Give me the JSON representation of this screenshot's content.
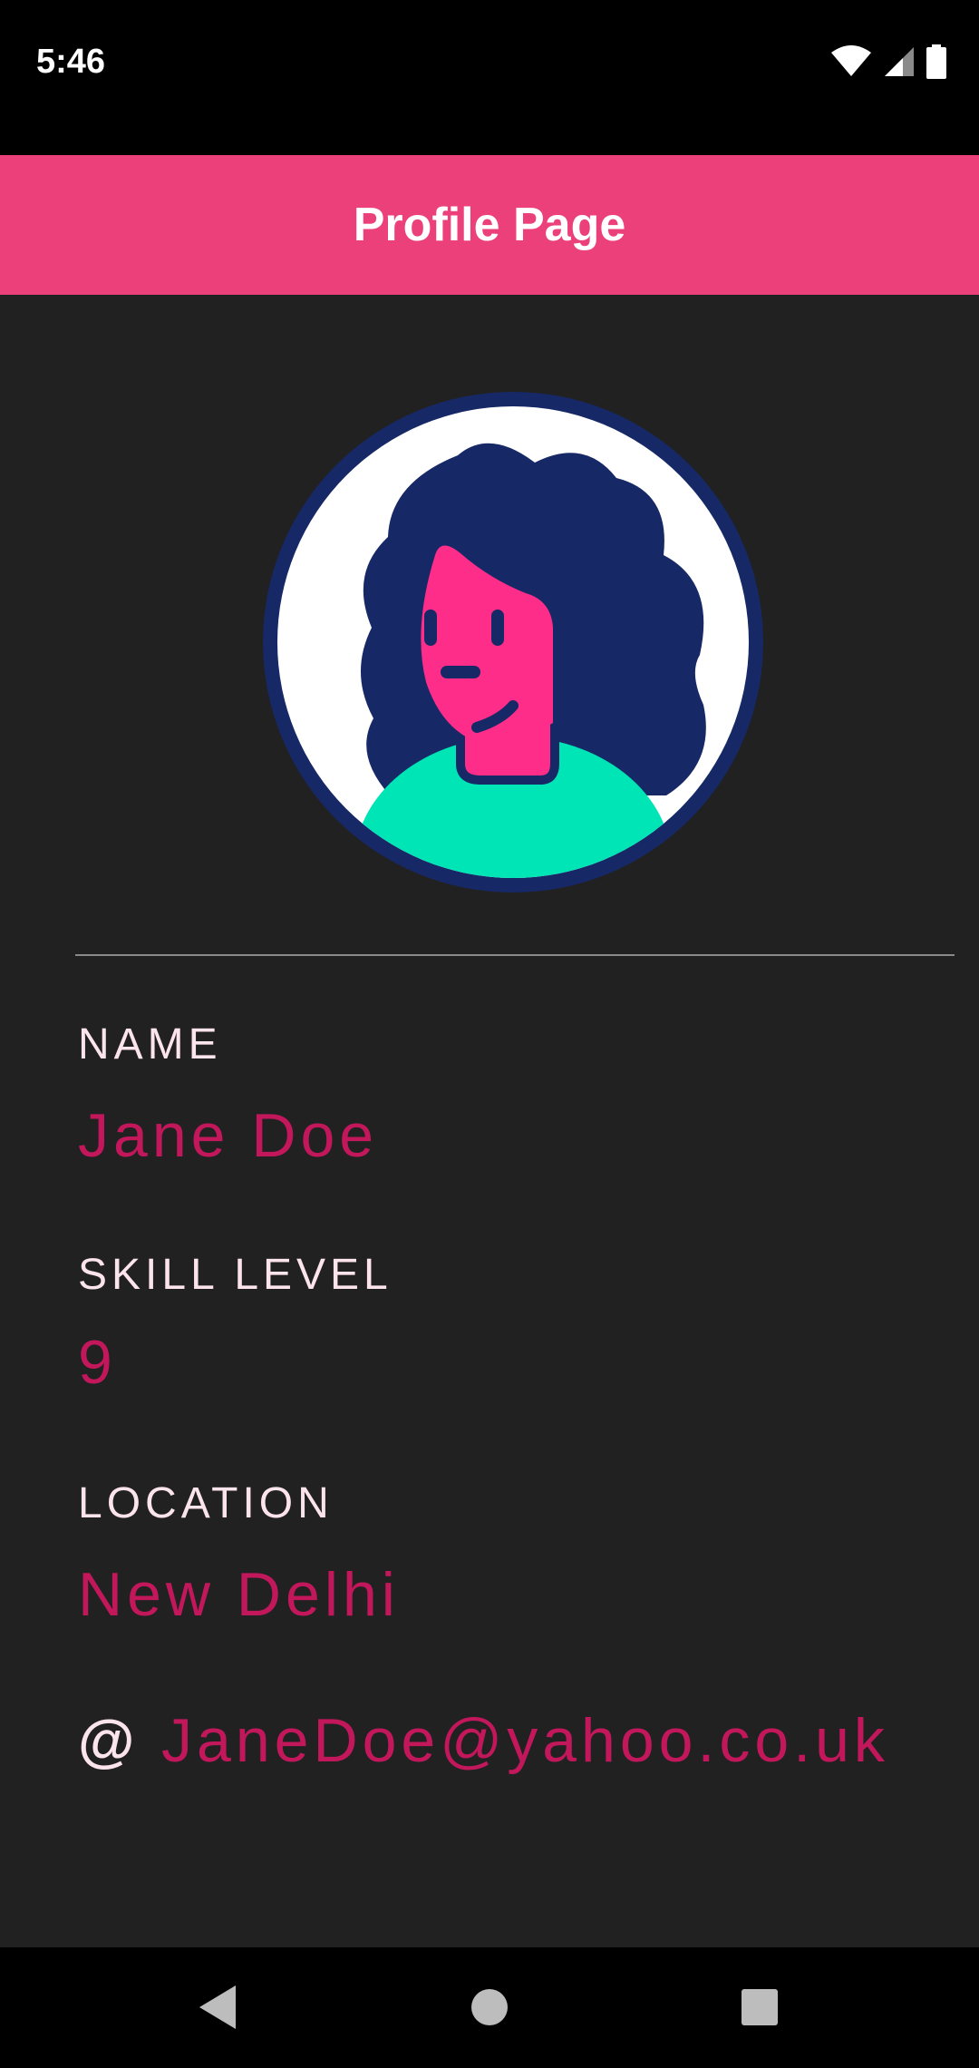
{
  "status_bar": {
    "time": "5:46",
    "icons": [
      "wifi-icon",
      "cell-signal-icon",
      "battery-icon"
    ]
  },
  "app_bar": {
    "title": "Profile Page",
    "color": "#EC407A"
  },
  "profile": {
    "avatar": "female-avatar",
    "fields": [
      {
        "label": "NAME",
        "value": "Jane Doe"
      },
      {
        "label": "SKILL LEVEL",
        "value": "9"
      },
      {
        "label": "LOCATION",
        "value": "New Delhi"
      }
    ],
    "email": {
      "icon": "@",
      "value": "JaneDoe@yahoo.co.uk"
    }
  },
  "colors": {
    "background": "#212121",
    "label": "#FCE4EC",
    "value": "#C2185B"
  },
  "nav_bar": {
    "buttons": [
      "back-icon",
      "home-icon",
      "recents-icon"
    ]
  }
}
